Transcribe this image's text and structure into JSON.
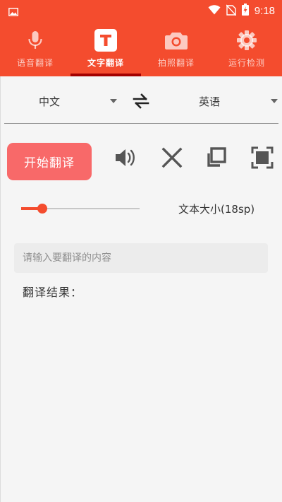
{
  "status_bar": {
    "time": "9:18",
    "left_icon": "image-icon",
    "right_icons": [
      "wifi-icon",
      "no-sim-icon",
      "battery-charging-icon"
    ]
  },
  "tabs": [
    {
      "label": "语音翻译",
      "icon": "microphone-icon",
      "active": false
    },
    {
      "label": "文字翻译",
      "icon": "text-t-icon",
      "active": true
    },
    {
      "label": "拍照翻译",
      "icon": "camera-icon",
      "active": false
    },
    {
      "label": "运行检测",
      "icon": "gear-icon",
      "active": false
    }
  ],
  "languages": {
    "source": "中文",
    "target": "英语"
  },
  "actions": {
    "start_label": "开始翻译"
  },
  "text_size": {
    "label": "文本大小(18sp)",
    "slider_fraction": 0.18
  },
  "input": {
    "value": "",
    "placeholder": "请输入要翻译的内容"
  },
  "result": {
    "label": "翻译结果："
  },
  "colors": {
    "brand": "#f44c2e",
    "tab_indicator": "#a30000",
    "start_button": "#f86969"
  }
}
